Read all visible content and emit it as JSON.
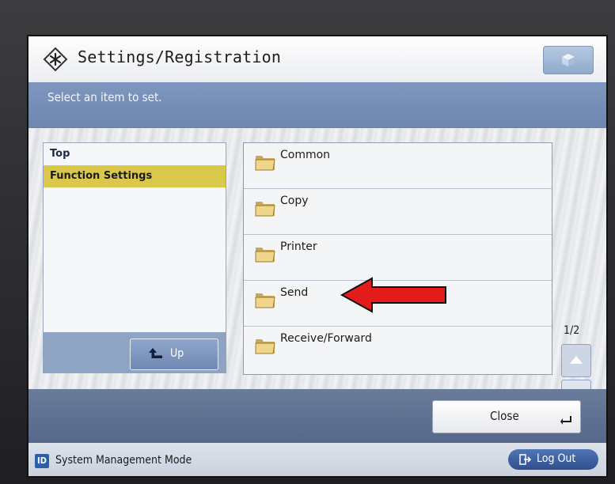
{
  "title": "Settings/Registration",
  "instruction": "Select an item to set.",
  "tree": {
    "items": [
      {
        "label": "Top",
        "selected": false
      },
      {
        "label": "Function Settings",
        "selected": true
      }
    ],
    "up_label": "Up"
  },
  "list": {
    "items": [
      {
        "label": "Common"
      },
      {
        "label": "Copy"
      },
      {
        "label": "Printer"
      },
      {
        "label": "Send"
      },
      {
        "label": "Receive/Forward"
      }
    ],
    "page_indicator": "1/2"
  },
  "close_label": "Close",
  "status": {
    "badge": "ID",
    "mode_text": "System Management Mode",
    "logout_label": "Log Out"
  },
  "colors": {
    "selected_highlight": "#d9c84a",
    "instruction_band": "#7f97be",
    "annotation_arrow": "#e31b1b"
  }
}
